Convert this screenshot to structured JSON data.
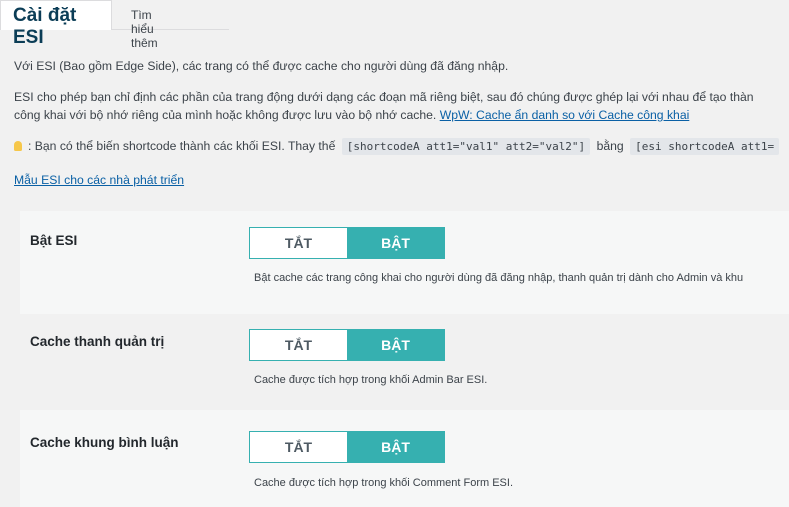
{
  "tabs": {
    "active": "Cài đặt ESI",
    "learn_more": "Tìm hiểu thêm"
  },
  "intro": {
    "p1": "Với ESI (Bao gồm Edge Side), các trang có thể được cache cho người dùng đã đăng nhập.",
    "p2_line1": "ESI cho phép bạn chỉ định các phần của trang động dưới dạng các đoạn mã riêng biệt, sau đó chúng được ghép lại với nhau để tạo thàn",
    "p2_line2": "công khai với bộ nhớ riêng của mình hoặc không được lưu vào bộ nhớ cache.",
    "p2_link": "WpW: Cache ẩn danh so với Cache công khai",
    "tip_prefix": ": Bạn có thể biến shortcode thành các khối ESI. Thay thế",
    "tip_code1": "[shortcodeA att1=\"val1\" att2=\"val2\"]",
    "tip_middle": "bằng",
    "tip_code2": "[esi shortcodeA att1=",
    "dev_link": "Mẫu ESI cho các nhà phát triển"
  },
  "settings": [
    {
      "label": "Bật ESI",
      "off": "TẮT",
      "on": "BẬT",
      "selected": "on",
      "description": "Bật cache các trang công khai cho người dùng đã đăng nhập, thanh quản trị dành cho Admin và khu"
    },
    {
      "label": "Cache thanh quản trị",
      "off": "TẮT",
      "on": "BẬT",
      "selected": "on",
      "description": "Cache được tích hợp trong khối Admin Bar ESI."
    },
    {
      "label": "Cache khung bình luận",
      "off": "TẮT",
      "on": "BẬT",
      "selected": "on",
      "description": "Cache được tích hợp trong khối Comment Form ESI."
    }
  ],
  "colors": {
    "accent": "#36b0b0",
    "title": "#0b3d56",
    "link": "#0a60a5"
  }
}
